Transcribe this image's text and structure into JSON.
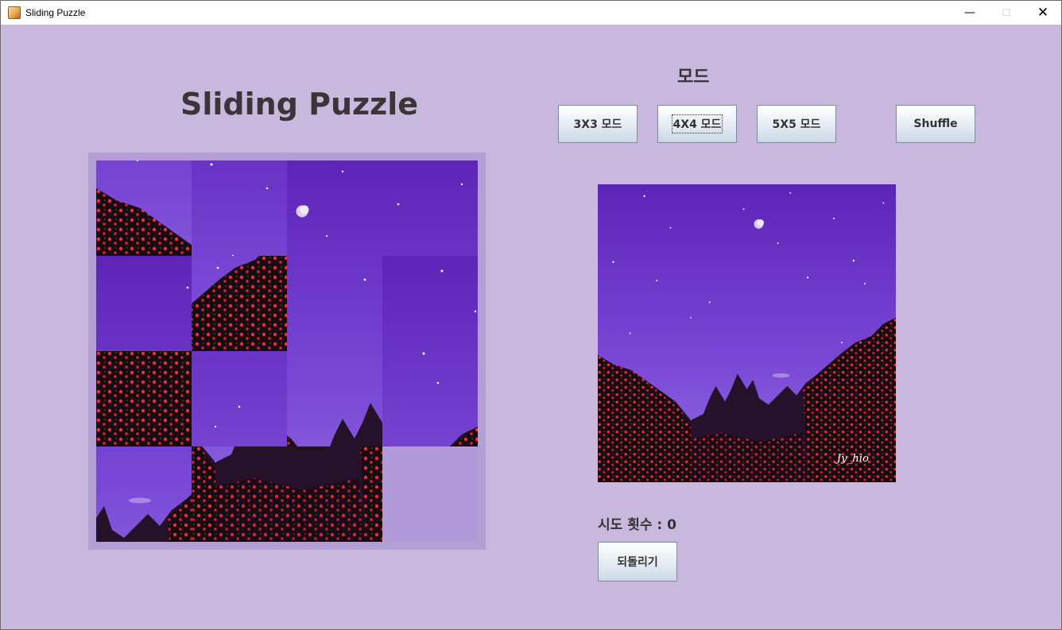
{
  "window": {
    "title": "Sliding Puzzle",
    "controls": {
      "minimize": "—",
      "maximize": "☐",
      "close": "✕"
    }
  },
  "header": {
    "title": "Sliding Puzzle"
  },
  "mode": {
    "title": "모드",
    "buttons": [
      {
        "label": "3X3 모드",
        "focused": false
      },
      {
        "label": "4X4 모드",
        "focused": true
      },
      {
        "label": "5X5 모드",
        "focused": false
      }
    ],
    "shuffle_label": "Shuffle"
  },
  "board": {
    "size": 4,
    "tiles": [
      8,
      4,
      2,
      3,
      1,
      11,
      6,
      0,
      12,
      5,
      9,
      7,
      10,
      13,
      14,
      null
    ]
  },
  "preview": {
    "watermark": "Jy_hio"
  },
  "stats": {
    "tries_label": "시도 횟수 : 0"
  },
  "actions": {
    "undo_label": "되돌리기"
  },
  "colors": {
    "background": "#c8b8de",
    "board_frame": "#b39fd4",
    "empty_tile": "#b29ad8",
    "sky_top": "#5d24b8",
    "sky_bottom": "#9270e0",
    "flower": "#e8303e"
  }
}
